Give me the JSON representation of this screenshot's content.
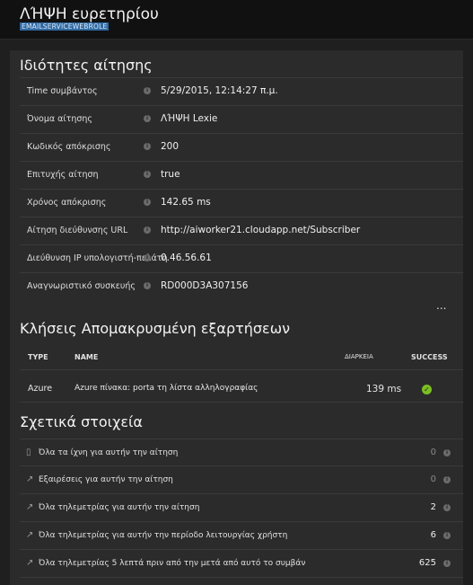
{
  "header": {
    "title": "ΛΉΨΗ ευρετηρίου",
    "subtitle": "EMAILSERVICEWEBROLE"
  },
  "properties": {
    "title": "Ιδιότητες αίτησης",
    "items": [
      {
        "label": "Time συμβάντος",
        "value": "5/29/2015, 12:14:27 π.μ."
      },
      {
        "label": "Όνομα αίτησης",
        "value": "ΛΉΨΗ Lexie"
      },
      {
        "label": "Κωδικός απόκρισης",
        "value": "200"
      },
      {
        "label": "Επιτυχής αίτηση",
        "value": "true"
      },
      {
        "label": "Χρόνος απόκρισης",
        "value": "142.65 ms"
      },
      {
        "label": "Αίτηση διεύθυνσης URL",
        "value": "http://aiworker21.cloudapp.net/Subscriber"
      },
      {
        "label": "Διεύθυνση IP υπολογιστή-πελάτη",
        "value": "0.46.56.61"
      },
      {
        "label": "Αναγνωριστικό συσκευής",
        "value": "RD000D3A307156"
      }
    ],
    "more_label": "..."
  },
  "dependencies": {
    "title": "Κλήσεις Απομακρυσμένη εξαρτήσεων",
    "headers": {
      "type": "TYPE",
      "name": "NAME",
      "duration": "ΔΙΑΡΚΕΙΑ",
      "success": "SUCCESS"
    },
    "rows": [
      {
        "type": "Azure",
        "name": "Azure πίνακα: porta τη λίστα αλληλογραφίας",
        "duration": "139 ms",
        "success_icon": "check-circle-icon"
      }
    ]
  },
  "related": {
    "title": "Σχετικά στοιχεία",
    "items": [
      {
        "icon": "document-icon",
        "label": "Όλα τα ίχνη για αυτήν την αίτηση",
        "count": "0"
      },
      {
        "icon": "arrow-icon",
        "label": "Εξαιρέσεις για αυτήν την αίτηση",
        "count": "0"
      },
      {
        "icon": "arrow-icon",
        "label": "Όλα τηλεμετρίας για αυτήν την αίτηση",
        "count": "2"
      },
      {
        "icon": "arrow-icon",
        "label": "Όλα τηλεμετρίας για αυτήν την περίοδο λειτουργίας χρήστη",
        "count": "6"
      },
      {
        "icon": "arrow-icon",
        "label": "Όλα τηλεμετρίας 5 λεπτά πριν από την μετά από αυτό το συμβάν",
        "count": "625"
      }
    ]
  },
  "colors": {
    "success": "#7bbf23",
    "highlight": "#2f6aa3"
  }
}
